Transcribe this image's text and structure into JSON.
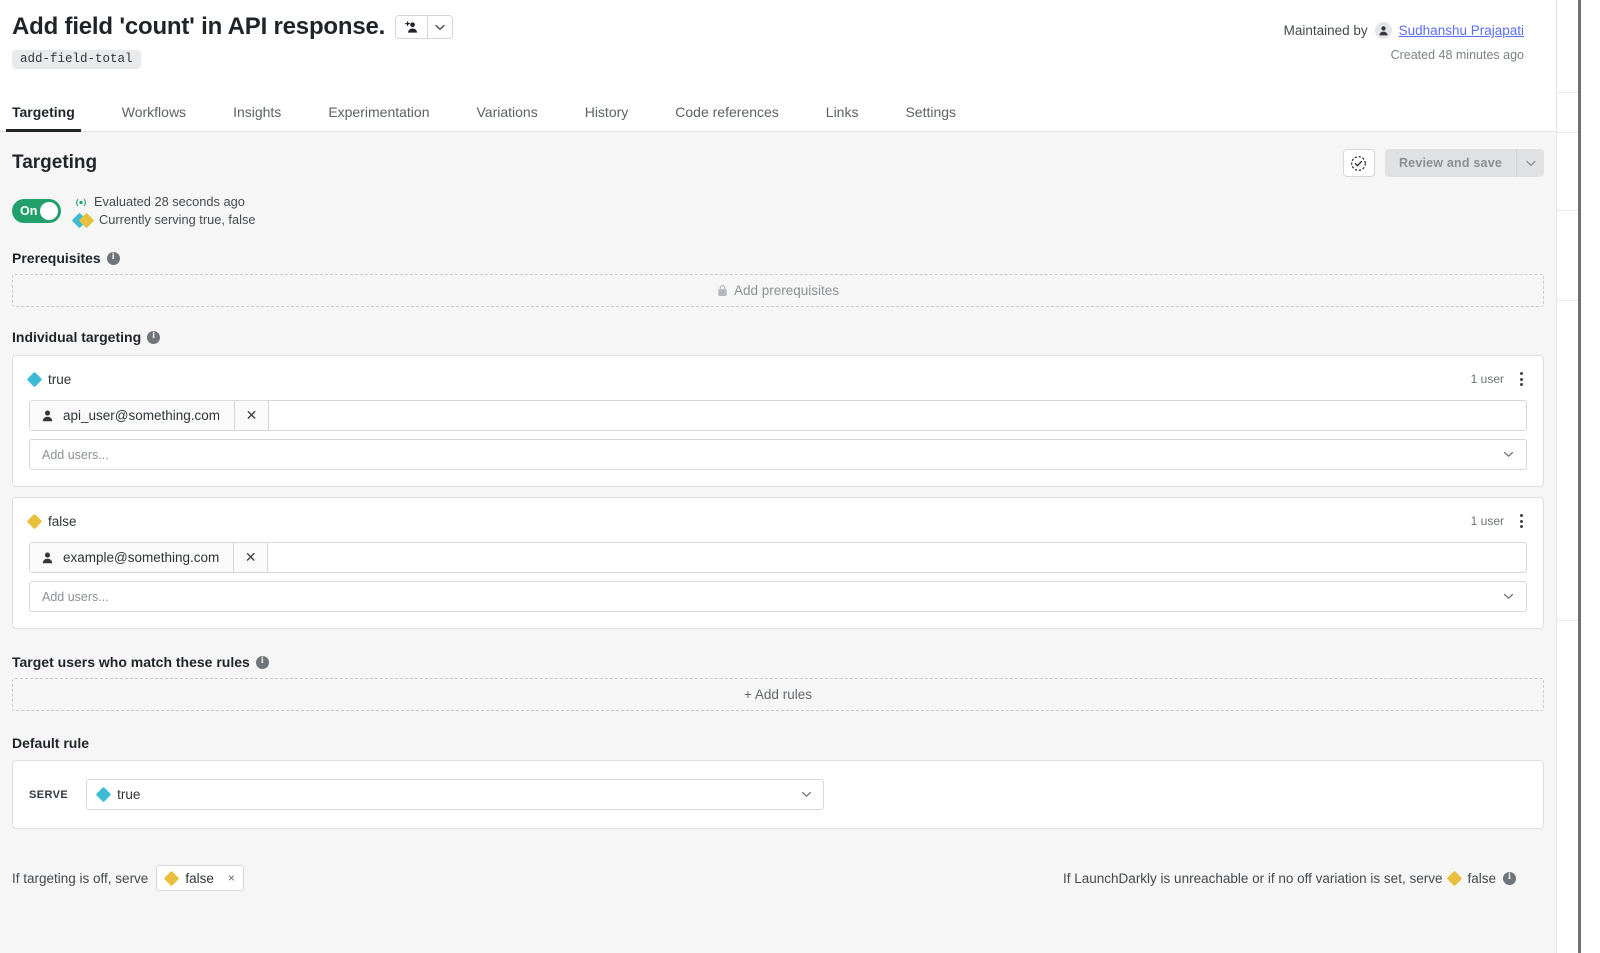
{
  "header": {
    "flag_title": "Add field 'count' in API response.",
    "flag_key": "add-field-total",
    "maintained_by_label": "Maintained by",
    "maintainer_name": "Sudhanshu Prajapati",
    "created_at": "Created 48 minutes ago",
    "add_maintainer_icon": "add-person-icon",
    "maintainer_caret_icon": "chevron-down-icon"
  },
  "tabs": [
    {
      "label": "Targeting",
      "active": true
    },
    {
      "label": "Workflows",
      "active": false
    },
    {
      "label": "Insights",
      "active": false
    },
    {
      "label": "Experimentation",
      "active": false
    },
    {
      "label": "Variations",
      "active": false
    },
    {
      "label": "History",
      "active": false
    },
    {
      "label": "Code references",
      "active": false
    },
    {
      "label": "Links",
      "active": false
    },
    {
      "label": "Settings",
      "active": false
    }
  ],
  "targeting": {
    "heading": "Targeting",
    "review_save_label": "Review and save",
    "review_save_caret_icon": "chevron-down-icon",
    "audit_icon": "check-circle-dashed-icon",
    "toggle_label": "On",
    "toggle_on": true,
    "toggle_color": "#22a06b",
    "evaluated_text": "Evaluated 28 seconds ago",
    "evaluated_icon": "broadcast-icon",
    "serving_text": "Currently serving true, false",
    "serving_icon": "dual-variation-icon"
  },
  "prerequisites": {
    "label": "Prerequisites",
    "info_icon": "info-icon",
    "empty_label": "Add prerequisites",
    "lock_icon": "lock-icon"
  },
  "individual_targeting": {
    "label": "Individual targeting",
    "info_icon": "info-icon",
    "cards": [
      {
        "variation": "true",
        "variation_color": "#3dbbd4",
        "user_count": "1 user",
        "kebab_icon": "kebab-menu-icon",
        "tokens": [
          {
            "text": "api_user@something.com",
            "avatar_icon": "person-icon",
            "remove_icon": "close-icon"
          }
        ],
        "add_placeholder": "Add users...",
        "caret_icon": "chevron-down-icon"
      },
      {
        "variation": "false",
        "variation_color": "#e9c03d",
        "user_count": "1 user",
        "kebab_icon": "kebab-menu-icon",
        "tokens": [
          {
            "text": "example@something.com",
            "avatar_icon": "person-icon",
            "remove_icon": "close-icon"
          }
        ],
        "add_placeholder": "Add users...",
        "caret_icon": "chevron-down-icon"
      }
    ]
  },
  "rules": {
    "label": "Target users who match these rules",
    "info_icon": "info-icon",
    "empty_label": "+ Add rules"
  },
  "default_rule": {
    "label": "Default rule",
    "serve_label": "SERVE",
    "serve_value": "true",
    "serve_value_color": "#3dbbd4",
    "caret_icon": "chevron-down-icon"
  },
  "footer": {
    "off_prefix": "If targeting is off, serve",
    "off_variation": "false",
    "off_variation_color": "#e9c03d",
    "off_remove_icon": "close-icon",
    "fallthrough_text": "If LaunchDarkly is unreachable or if no off variation is set, serve",
    "fallthrough_variation": "false",
    "fallthrough_variation_color": "#e9c03d",
    "info_icon": "info-icon"
  }
}
